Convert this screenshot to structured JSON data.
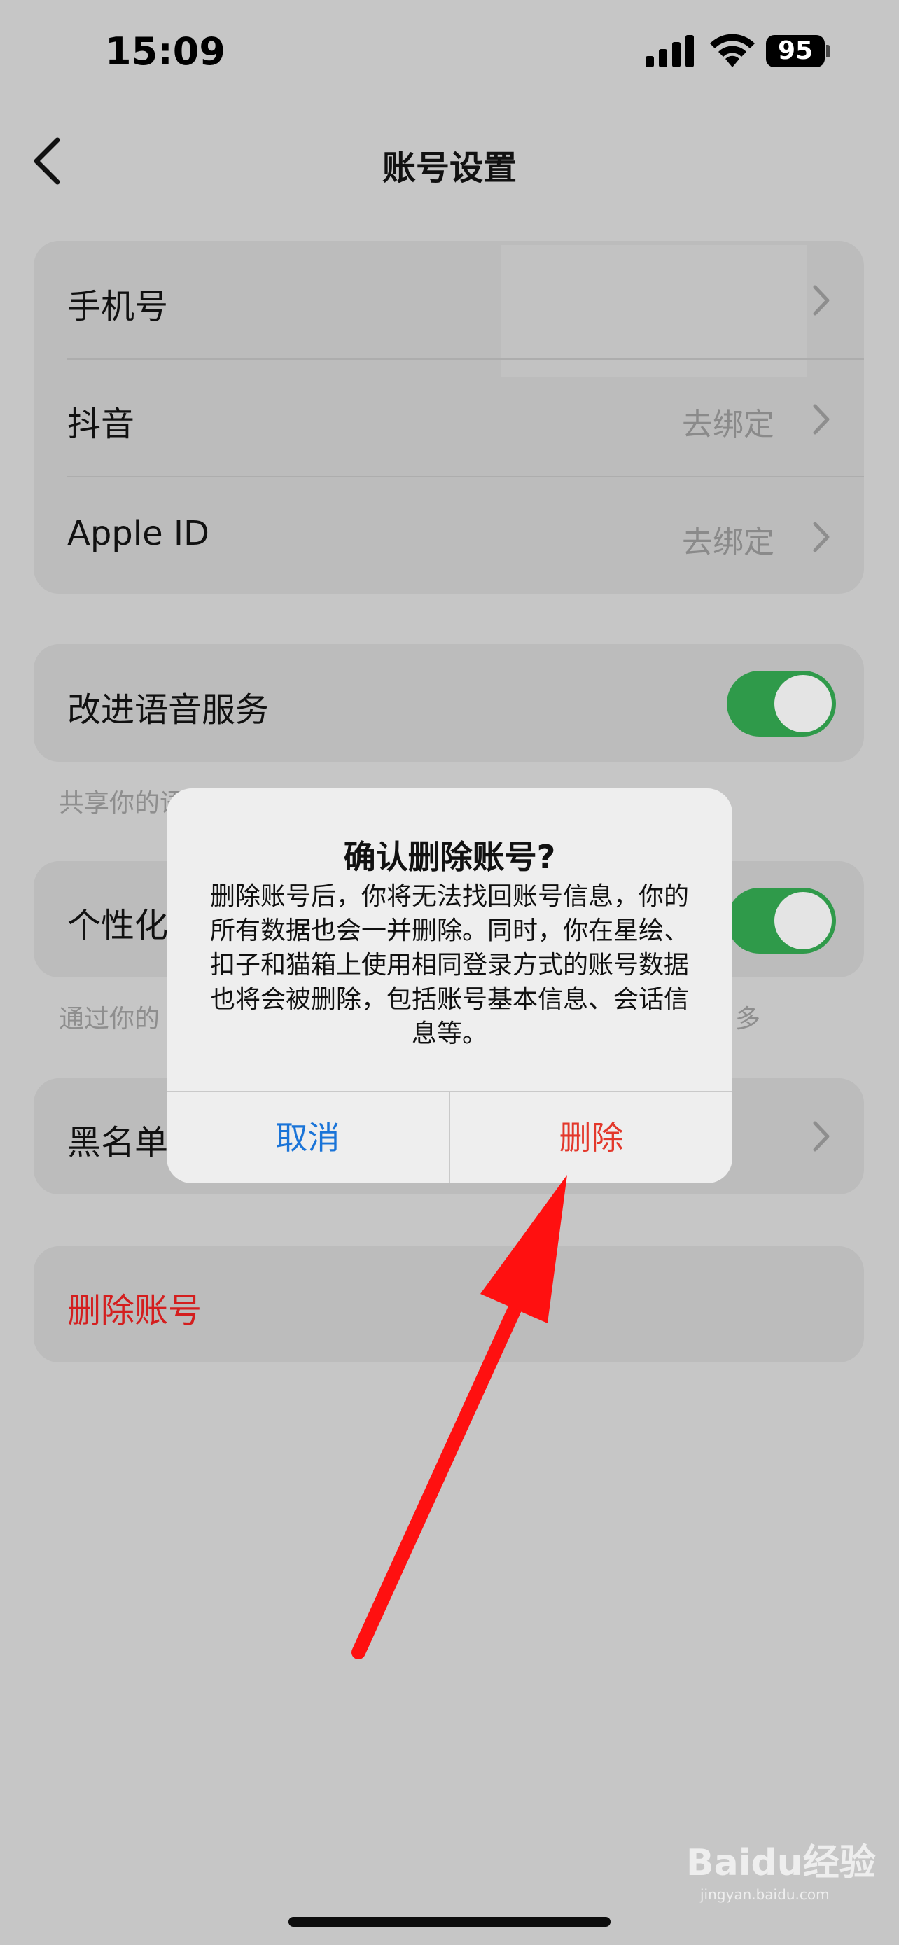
{
  "status_bar": {
    "time": "15:09",
    "battery": "95"
  },
  "nav": {
    "title": "账号设置"
  },
  "accounts": {
    "phone_label": "手机号",
    "douyin_label": "抖音",
    "douyin_value": "去绑定",
    "apple_label": "Apple ID",
    "apple_value": "去绑定"
  },
  "voice": {
    "label": "改进语音服务",
    "toggle_on": true,
    "footnote": "共享你的语音数据来帮助改进语音服务。了解更多"
  },
  "personal": {
    "label": "个性化",
    "toggle_on": true,
    "footnote": "通过你的",
    "footnote_tail": "多"
  },
  "blacklist": {
    "label": "黑名单"
  },
  "delete_account": {
    "label": "删除账号"
  },
  "alert": {
    "title": "确认删除账号?",
    "message": "删除账号后，你将无法找回账号信息，你的所有数据也会一并删除。同时，你在星绘、扣子和猫箱上使用相同登录方式的账号数据也将会被删除，包括账号基本信息、会话信息等。",
    "cancel_label": "取消",
    "delete_label": "删除"
  },
  "watermark": {
    "text": "Baidu经验",
    "sub": "jingyan.baidu.com"
  },
  "colors": {
    "toggle_on": "#2f9a4a",
    "destructive": "#e3382b",
    "link": "#1a74d8",
    "annotation_arrow": "#ff1010"
  }
}
